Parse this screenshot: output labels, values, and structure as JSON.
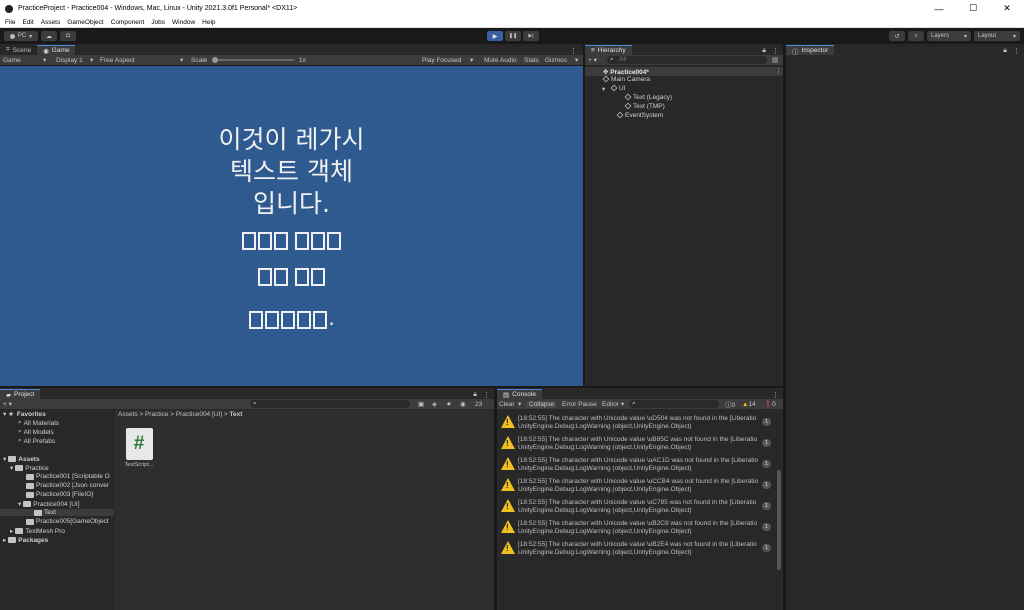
{
  "window": {
    "title": "PracticeProject - Practice004 - Windows, Mac, Linux - Unity 2021.3.0f1 Personal* <DX11>",
    "controls": [
      "—",
      "☐",
      "✕"
    ]
  },
  "menu": [
    "File",
    "Edit",
    "Assets",
    "GameObject",
    "Component",
    "Jobs",
    "Window",
    "Help"
  ],
  "toolbar": {
    "account_label": "PC",
    "play_icon": "▶",
    "pause_icon": "❚❚",
    "step_icon": "▶|",
    "layers_label": "Layers",
    "layout_label": "Layout"
  },
  "game_panel": {
    "tabs": [
      "Scene",
      "Game"
    ],
    "display_label": "Game",
    "display": "Display 1",
    "aspect": "Free Aspect",
    "scale_label": "Scale",
    "scale_value": "1x",
    "play_focused": "Play Focused",
    "mute_audio": "Mute Audio",
    "stats": "Stats",
    "gizmos": "Gizmos",
    "legacy_text_lines": [
      "이것이 레가시",
      "텍스트 객체",
      "입니다."
    ],
    "tmp_text_suffix": "."
  },
  "hierarchy": {
    "tab": "Hierarchy",
    "search_placeholder": "All",
    "scene": "Practice004*",
    "items": [
      "Main Camera",
      "UI",
      "Text (Legacy)",
      "Text (TMP)",
      "EventSystem"
    ]
  },
  "inspector": {
    "tab": "Inspector"
  },
  "project": {
    "tab": "Project",
    "favorites_label": "Favorites",
    "favorites": [
      "All Materials",
      "All Models",
      "All Prefabs"
    ],
    "assets_label": "Assets",
    "practice": "Practice",
    "folders": [
      "Practice001 [Scriptable O",
      "Practice002 [Json conver",
      "Practice003 [FileIO]",
      "Practice004 [UI]",
      "Text",
      "Practice005[GameObject",
      "TextMesh Pro"
    ],
    "packages": "Packages",
    "breadcrumb": [
      "Assets",
      "Practice",
      "Practice004 [UI]",
      "Text"
    ],
    "file_name": "TextScript...",
    "file_icon_glyph": "#",
    "hidden_count": "23"
  },
  "console": {
    "tab": "Console",
    "clear": "Clear",
    "collapse": "Collapse",
    "error_pause": "Error Pause",
    "editor": "Editor",
    "counts": {
      "info": "0",
      "warn": "14",
      "error": "0"
    },
    "logs": [
      {
        "line1": "[18:52:55] The character with Unicode value \\uD504 was not found in the [Liberatio",
        "line2": "UnityEngine.Debug:LogWarning (object,UnityEngine.Object)",
        "count": "1"
      },
      {
        "line1": "[18:52:55] The character with Unicode value \\uB85C was not found in the [Liberatio",
        "line2": "UnityEngine.Debug:LogWarning (object,UnityEngine.Object)",
        "count": "1"
      },
      {
        "line1": "[18:52:55] The character with Unicode value \\uAC1D was not found in the [Liberatio",
        "line2": "UnityEngine.Debug:LogWarning (object,UnityEngine.Object)",
        "count": "1"
      },
      {
        "line1": "[18:52:55] The character with Unicode value \\uCCB4 was not found in the [Liberatio",
        "line2": "UnityEngine.Debug:LogWarning (object,UnityEngine.Object)",
        "count": "1"
      },
      {
        "line1": "[18:52:55] The character with Unicode value \\uC785 was not found in the [Liberatio",
        "line2": "UnityEngine.Debug:LogWarning (object,UnityEngine.Object)",
        "count": "1"
      },
      {
        "line1": "[18:52:55] The character with Unicode value \\uB2C8 was not found in the [Liberatio",
        "line2": "UnityEngine.Debug:LogWarning (object,UnityEngine.Object)",
        "count": "1"
      },
      {
        "line1": "[18:52:55] The character with Unicode value \\uB2E4 was not found in the [Liberatio",
        "line2": "UnityEngine.Debug:LogWarning (object,UnityEngine.Object)",
        "count": "1"
      }
    ]
  },
  "colors": {
    "accent": "#4a89dc",
    "game_bg": "#2e5a8f",
    "warn": "#f0c020"
  }
}
